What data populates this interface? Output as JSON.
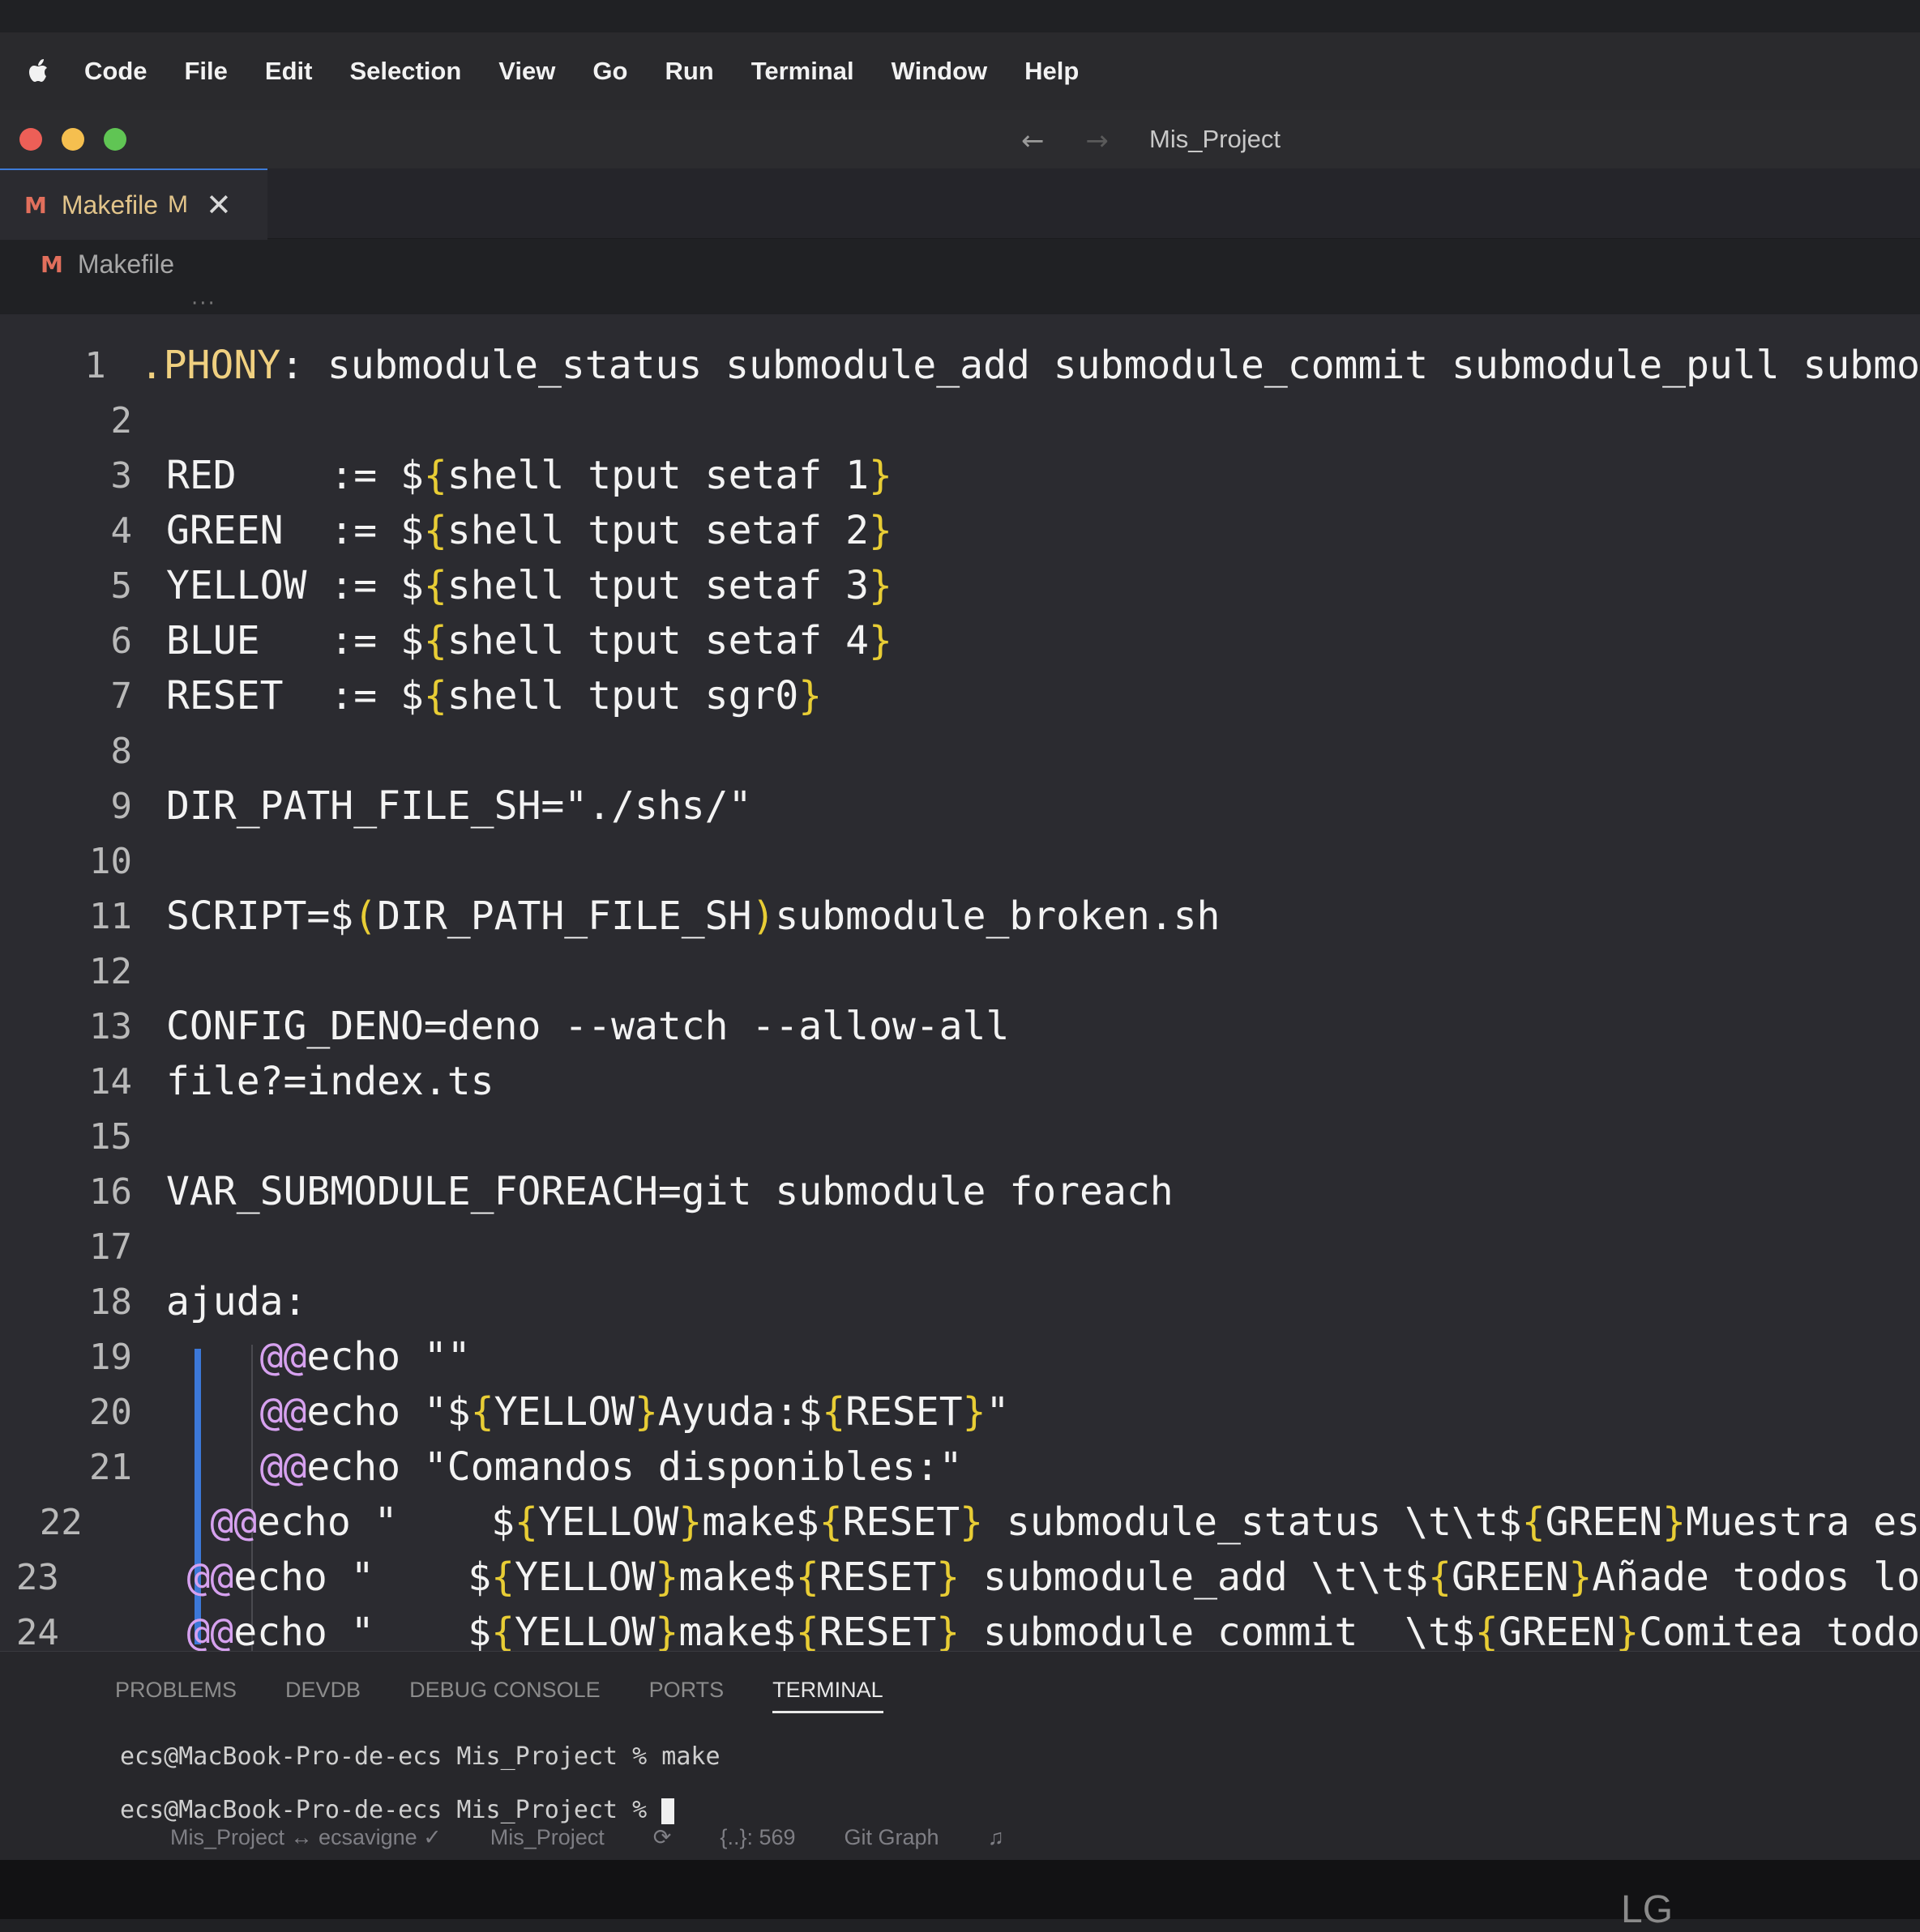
{
  "menubar": {
    "items": [
      "Code",
      "File",
      "Edit",
      "Selection",
      "View",
      "Go",
      "Run",
      "Terminal",
      "Window",
      "Help"
    ]
  },
  "titlebar": {
    "project": "Mis_Project",
    "traffic_colors": [
      "#ed5f57",
      "#f5bf4f",
      "#60c554"
    ]
  },
  "tab": {
    "icon": "M",
    "label": "Makefile",
    "modified": "M"
  },
  "breadcrumb": {
    "icon": "M",
    "label": "Makefile"
  },
  "editor": {
    "lines": [
      {
        "n": "1",
        "text": ".PHONY: submodule_status submodule_add submodule_commit submodule_pull submo"
      },
      {
        "n": "2",
        "text": ""
      },
      {
        "n": "3",
        "text": "RED    := ${shell tput setaf 1}"
      },
      {
        "n": "4",
        "text": "GREEN  := ${shell tput setaf 2}"
      },
      {
        "n": "5",
        "text": "YELLOW := ${shell tput setaf 3}"
      },
      {
        "n": "6",
        "text": "BLUE   := ${shell tput setaf 4}"
      },
      {
        "n": "7",
        "text": "RESET  := ${shell tput sgr0}"
      },
      {
        "n": "8",
        "text": ""
      },
      {
        "n": "9",
        "text": "DIR_PATH_FILE_SH=\"./shs/\""
      },
      {
        "n": "10",
        "text": ""
      },
      {
        "n": "11",
        "text": "SCRIPT=$(DIR_PATH_FILE_SH)submodule_broken.sh"
      },
      {
        "n": "12",
        "text": ""
      },
      {
        "n": "13",
        "text": "CONFIG_DENO=deno --watch --allow-all"
      },
      {
        "n": "14",
        "text": "file?=index.ts"
      },
      {
        "n": "15",
        "text": ""
      },
      {
        "n": "16",
        "text": "VAR_SUBMODULE_FOREACH=git submodule foreach"
      },
      {
        "n": "17",
        "text": ""
      },
      {
        "n": "18",
        "text": "ajuda:"
      },
      {
        "n": "19",
        "text": "    @@echo \"\""
      },
      {
        "n": "20",
        "text": "    @@echo \"${YELLOW}Ayuda:${RESET}\""
      },
      {
        "n": "21",
        "text": "    @@echo \"Comandos disponibles:\""
      },
      {
        "n": "22",
        "text": "    @@echo \"    ${YELLOW}make${RESET} submodule_status \\t\\t${GREEN}Muestra es"
      },
      {
        "n": "23",
        "text": "    @@echo \"    ${YELLOW}make${RESET} submodule_add \\t\\t${GREEN}Añade todos lo"
      },
      {
        "n": "24",
        "text": "    @@echo \"    ${YELLOW}make${RESET} submodule_commit  \\t${GREEN}Comitea todo"
      }
    ]
  },
  "panel": {
    "tabs": [
      "PROBLEMS",
      "DEVDB",
      "DEBUG CONSOLE",
      "PORTS",
      "TERMINAL"
    ],
    "active_tab": "TERMINAL",
    "terminal_lines": [
      "ecs@MacBook-Pro-de-ecs Mis_Project % make",
      "ecs@MacBook-Pro-de-ecs Mis_Project % "
    ]
  },
  "statusbar": {
    "items": [
      "Mis_Project ↔ ecsavigne ✓",
      "Mis_Project",
      "{..}: 569",
      "Git Graph"
    ]
  },
  "monitor": {
    "logo": "LG"
  }
}
